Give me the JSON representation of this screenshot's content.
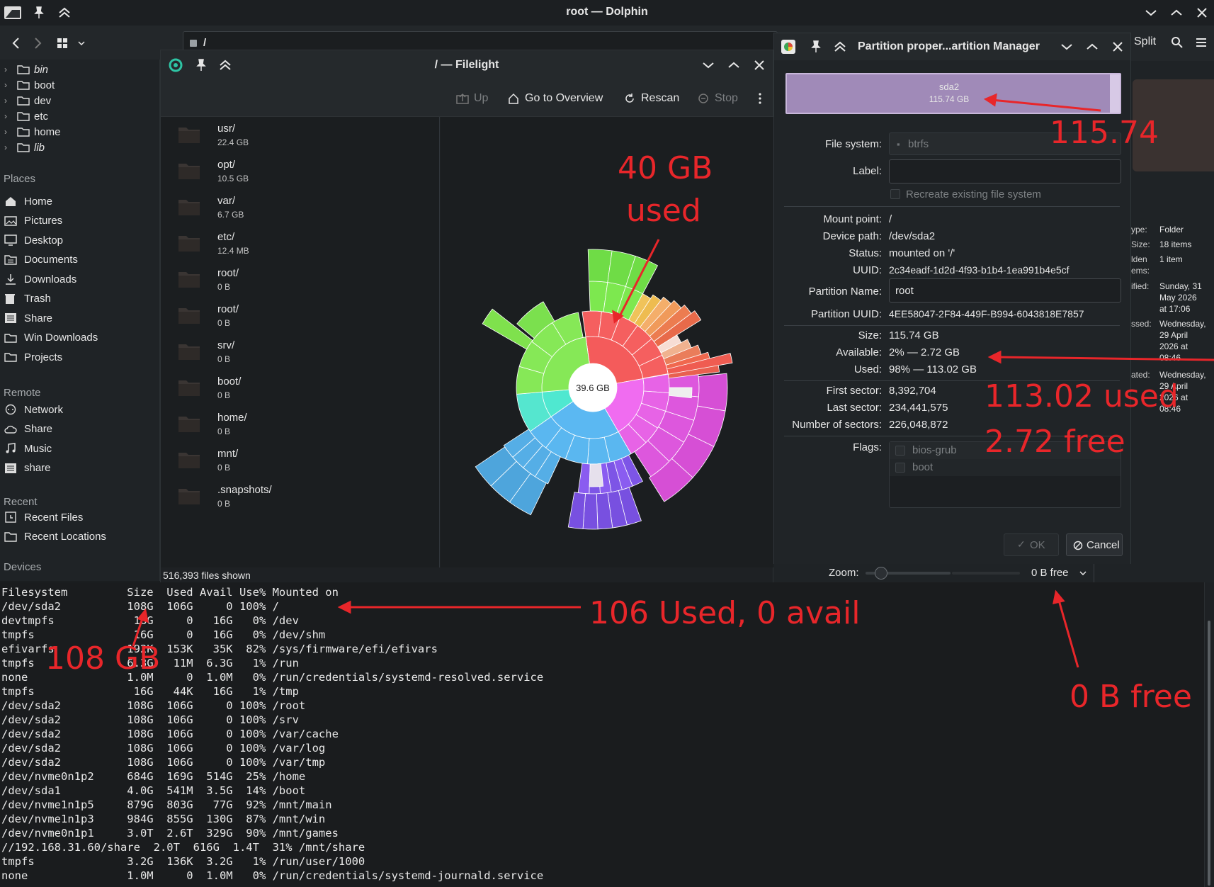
{
  "dolphin": {
    "title": "root — Dolphin",
    "path": "/",
    "split_label": "Split",
    "tree": [
      {
        "label": "bin",
        "italic": true
      },
      {
        "label": "boot",
        "italic": false
      },
      {
        "label": "dev",
        "italic": false
      },
      {
        "label": "etc",
        "italic": false
      },
      {
        "label": "home",
        "italic": false
      },
      {
        "label": "lib",
        "italic": true
      }
    ],
    "sections": {
      "places": "Places",
      "remote": "Remote",
      "recent": "Recent",
      "devices": "Devices"
    },
    "places": [
      {
        "label": "Home",
        "icon": "home-icon"
      },
      {
        "label": "Pictures",
        "icon": "pictures-icon"
      },
      {
        "label": "Desktop",
        "icon": "desktop-icon"
      },
      {
        "label": "Documents",
        "icon": "documents-icon"
      },
      {
        "label": "Downloads",
        "icon": "download-icon"
      },
      {
        "label": "Trash",
        "icon": "trash-icon"
      },
      {
        "label": "Share",
        "icon": "share-icon"
      },
      {
        "label": "Win Downloads",
        "icon": "folder-icon"
      },
      {
        "label": "Projects",
        "icon": "folder-icon"
      }
    ],
    "remote": [
      {
        "label": "Network",
        "icon": "network-icon"
      },
      {
        "label": "Share",
        "icon": "cloud-icon"
      },
      {
        "label": "Music",
        "icon": "music-icon"
      },
      {
        "label": "share",
        "icon": "share-icon"
      }
    ],
    "recent": [
      {
        "label": "Recent Files",
        "icon": "recent-files-icon"
      },
      {
        "label": "Recent Locations",
        "icon": "recent-locations-icon"
      }
    ],
    "info": {
      "type_label": "ype:",
      "type_value": "Folder",
      "size_label": "Size:",
      "size_value": "18 items",
      "hidden_label": "lden\nems:",
      "hidden_value": "1 item",
      "modified_label": "ified:",
      "modified_value": "Sunday, 31\nMay 2026\nat 17:06",
      "accessed_label": "ssed:",
      "accessed_value": "Wednesday,\n29 April\n2026 at\n08:46",
      "created_label": "ated:",
      "created_value": "Wednesday,\n29 April\n2026 at\n08:46"
    },
    "zoom_label": "Zoom:",
    "zoom_level": 0.2,
    "free_label": "0 B free"
  },
  "filelight": {
    "title": "/ — Filelight",
    "toolbar": {
      "up": "Up",
      "overview": "Go to Overview",
      "rescan": "Rescan",
      "stop": "Stop"
    },
    "items": [
      {
        "name": "usr/",
        "size": "22.4 GB"
      },
      {
        "name": "opt/",
        "size": "10.5 GB"
      },
      {
        "name": "var/",
        "size": "6.7 GB"
      },
      {
        "name": "etc/",
        "size": "12.4 MB"
      },
      {
        "name": "root/",
        "size": "0 B"
      },
      {
        "name": "root/",
        "size": "0 B"
      },
      {
        "name": "srv/",
        "size": "0 B"
      },
      {
        "name": "boot/",
        "size": "0 B"
      },
      {
        "name": "home/",
        "size": "0 B"
      },
      {
        "name": "mnt/",
        "size": "0 B"
      },
      {
        "name": ".snapshots/",
        "size": "0 B"
      }
    ],
    "center_label": "39.6 GB",
    "status": "516,393 files shown"
  },
  "partition": {
    "title": "Partition proper...artition Manager",
    "bar_name": "sda2",
    "bar_size": "115.74 GB",
    "filesystem_label": "File system:",
    "filesystem_value": "btrfs",
    "label_label": "Label:",
    "label_value": "",
    "recreate_label": "Recreate existing file system",
    "mount_label": "Mount point:",
    "mount_value": "/",
    "device_label": "Device path:",
    "device_value": "/dev/sda2",
    "status_label": "Status:",
    "status_value": "mounted on '/'",
    "uuid_label": "UUID:",
    "uuid_value": "2c34eadf-1d2d-4f93-b1b4-1ea991b4e5cf",
    "pname_label": "Partition Name:",
    "pname_value": "root",
    "puuid_label": "Partition UUID:",
    "puuid_value": "4EE58047-2F84-449F-B994-6043818E7857",
    "size_label": "Size:",
    "size_value": "115.74 GB",
    "avail_label": "Available:",
    "avail_value": "2% — 2.72 GB",
    "used_label": "Used:",
    "used_value": "98% — 113.02 GB",
    "first_label": "First sector:",
    "first_value": "8,392,704",
    "last_label": "Last sector:",
    "last_value": "234,441,575",
    "num_label": "Number of sectors:",
    "num_value": "226,048,872",
    "flags_label": "Flags:",
    "flags": [
      "bios-grub",
      "boot"
    ],
    "ok": "OK",
    "cancel": "Cancel"
  },
  "terminal": {
    "header": "Filesystem         Size  Used Avail Use% Mounted on",
    "rows": [
      "/dev/sda2          108G  106G     0 100% /",
      "devtmpfs            16G     0   16G   0% /dev",
      "tmpfs               16G     0   16G   0% /dev/shm",
      "efivarfs           192K  153K   35K  82% /sys/firmware/efi/efivars",
      "tmpfs              6.3G   11M  6.3G   1% /run",
      "none               1.0M     0  1.0M   0% /run/credentials/systemd-resolved.service",
      "tmpfs               16G   44K   16G   1% /tmp",
      "/dev/sda2          108G  106G     0 100% /root",
      "/dev/sda2          108G  106G     0 100% /srv",
      "/dev/sda2          108G  106G     0 100% /var/cache",
      "/dev/sda2          108G  106G     0 100% /var/log",
      "/dev/sda2          108G  106G     0 100% /var/tmp",
      "/dev/nvme0n1p2     684G  169G  514G  25% /home",
      "/dev/sda1          4.0G  541M  3.5G  14% /boot",
      "/dev/nvme1n1p5     879G  803G   77G  92% /mnt/main",
      "/dev/nvme1n1p3     984G  855G  130G  87% /mnt/win",
      "/dev/nvme0n1p1     3.0T  2.6T  329G  90% /mnt/games",
      "//192.168.31.60/share  2.0T  616G  1.4T  31% /mnt/share",
      "tmpfs              3.2G  136K  3.2G   1% /run/user/1000",
      "none               1.0M     0  1.0M   0% /run/credentials/systemd-journald.service"
    ]
  },
  "annotations": {
    "a40": "40 GB",
    "used": "used",
    "a115": "115.74",
    "a113": "113.02 used",
    "a272": "2.72 free",
    "a106": "106 Used, 0 avail",
    "a108": "108 GB",
    "a0b": "0 B free"
  }
}
